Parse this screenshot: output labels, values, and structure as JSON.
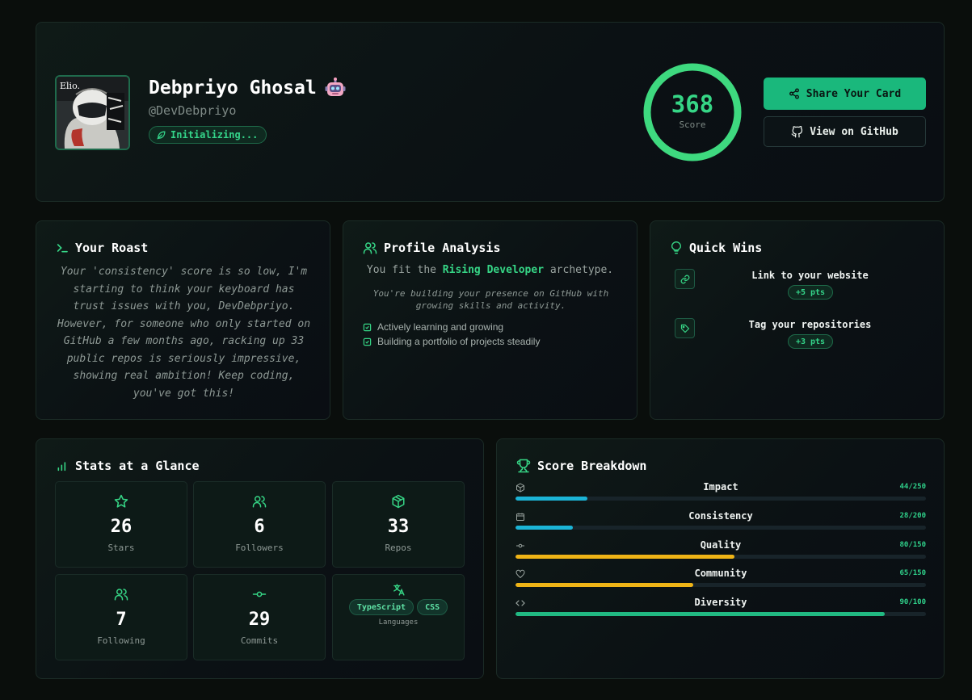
{
  "profile": {
    "name": "Debpriyo Ghosal",
    "handle": "@DevDebpriyo",
    "status": "Initializing...",
    "avatar_text": "Elio."
  },
  "score": {
    "value": "368",
    "label": "Score",
    "max_fraction": 1.0
  },
  "actions": {
    "share_label": "Share Your Card",
    "github_label": "View on GitHub"
  },
  "roast": {
    "title": "Your Roast",
    "text": "Your 'consistency' score is so low, I'm starting to think your keyboard has trust issues with you, DevDebpriyo. However, for someone who only started on GitHub a few months ago, racking up 33 public repos is seriously impressive, showing real ambition! Keep coding, you've got this!"
  },
  "analysis": {
    "title": "Profile Analysis",
    "prefix": "You fit the ",
    "archetype": "Rising Developer",
    "suffix": " archetype.",
    "description": "You're building your presence on GitHub with growing skills and activity.",
    "traits": [
      "Actively learning and growing",
      "Building a portfolio of projects steadily"
    ]
  },
  "quick_wins": {
    "title": "Quick Wins",
    "items": [
      {
        "label": "Link to your website",
        "points": "+5 pts",
        "icon": "link-icon"
      },
      {
        "label": "Tag your repositories",
        "points": "+3 pts",
        "icon": "tag-icon"
      }
    ]
  },
  "stats": {
    "title": "Stats at a Glance",
    "tiles": [
      {
        "value": "26",
        "label": "Stars",
        "icon": "star-icon"
      },
      {
        "value": "6",
        "label": "Followers",
        "icon": "users-icon"
      },
      {
        "value": "33",
        "label": "Repos",
        "icon": "package-icon"
      },
      {
        "value": "7",
        "label": "Following",
        "icon": "users-icon"
      },
      {
        "value": "29",
        "label": "Commits",
        "icon": "commit-icon"
      }
    ],
    "languages": {
      "label": "Languages",
      "items": [
        "TypeScript",
        "CSS"
      ],
      "icon": "translate-icon"
    }
  },
  "breakdown": {
    "title": "Score Breakdown",
    "rows": [
      {
        "name": "Impact",
        "value": "44/250",
        "fraction": 0.176,
        "color": "#1bb4d6",
        "icon": "package-icon"
      },
      {
        "name": "Consistency",
        "value": "28/200",
        "fraction": 0.14,
        "color": "#1bb4d6",
        "icon": "calendar-icon"
      },
      {
        "name": "Quality",
        "value": "80/150",
        "fraction": 0.533,
        "color": "#efb416",
        "icon": "commit-icon"
      },
      {
        "name": "Community",
        "value": "65/150",
        "fraction": 0.433,
        "color": "#efb416",
        "icon": "heart-icon"
      },
      {
        "name": "Diversity",
        "value": "90/100",
        "fraction": 0.9,
        "color": "#21b982",
        "icon": "code-icon"
      }
    ]
  },
  "colors": {
    "accent": "#36d686",
    "button": "#1ab87c",
    "background": "#0a0e0c"
  }
}
